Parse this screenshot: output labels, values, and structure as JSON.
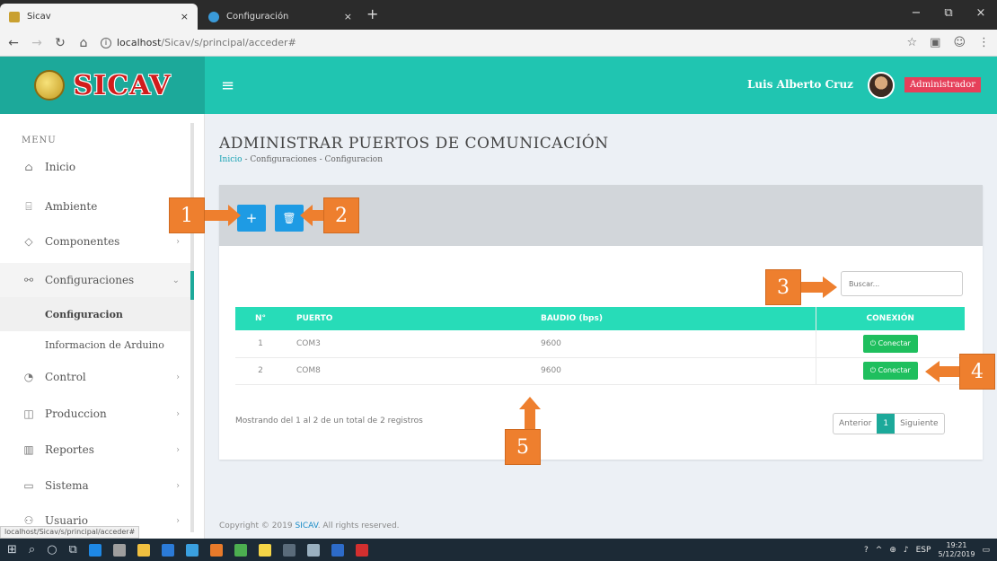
{
  "browser": {
    "tabs": [
      {
        "title": "Sicav",
        "close": "×"
      },
      {
        "title": "Configuración",
        "close": "×"
      }
    ],
    "new_tab": "+",
    "window_controls": {
      "minimize": "−",
      "maximize": "⧉",
      "close": "×"
    },
    "url_host": "localhost",
    "url_path": "/Sicav/s/principal/acceder#",
    "status_url": "localhost/Sicav/s/principal/acceder#"
  },
  "header": {
    "logo_text": "SICAV",
    "menu_icon": "hamburger-icon",
    "user_name": "Luis Alberto Cruz",
    "role": "Administrador"
  },
  "sidebar": {
    "title": "MENU",
    "items": [
      {
        "label": "Inicio",
        "icon": "home-icon"
      },
      {
        "label": "Ambiente",
        "icon": "bank-icon"
      },
      {
        "label": "Componentes",
        "icon": "cube-icon",
        "chevron": "›"
      },
      {
        "label": "Configuraciones",
        "icon": "link-icon",
        "chevron": "⌄"
      },
      {
        "label": "Configuracion"
      },
      {
        "label": "Informacion de Arduino"
      },
      {
        "label": "Control",
        "icon": "gauge-icon",
        "chevron": "›"
      },
      {
        "label": "Produccion",
        "icon": "box-icon",
        "chevron": "›"
      },
      {
        "label": "Reportes",
        "icon": "chart-icon",
        "chevron": "›"
      },
      {
        "label": "Sistema",
        "icon": "terminal-icon",
        "chevron": "›"
      },
      {
        "label": "Usuario",
        "icon": "users-icon",
        "chevron": "›"
      }
    ]
  },
  "main": {
    "title": "ADMINISTRAR PUERTOS DE COMUNICACIÓN",
    "breadcrumb": {
      "home": "Inicio",
      "sep": " - ",
      "level1": "Configuraciones",
      "level2": "Configuracion"
    },
    "add_button": "+",
    "delete_button": "🗑",
    "search_placeholder": "Buscar...",
    "table": {
      "headers": [
        "N°",
        "PUERTO",
        "BAUDIO (bps)",
        "CONEXIÓN"
      ],
      "rows": [
        {
          "n": "1",
          "port": "COM3",
          "baud": "9600",
          "action": "⏻ Conectar"
        },
        {
          "n": "2",
          "port": "COM8",
          "baud": "9600",
          "action": "⏻ Conectar"
        }
      ]
    },
    "showing_text": "Mostrando del 1 al 2 de un total de 2 registros",
    "pager": {
      "prev": "Anterior",
      "current": "1",
      "next": "Siguiente"
    },
    "footer": {
      "prefix": "Copyright © 2019 ",
      "brand": "SICAV",
      "suffix": ". All rights reserved."
    }
  },
  "callouts": [
    "1",
    "2",
    "3",
    "4",
    "5"
  ],
  "taskbar": {
    "lang": "ESP",
    "time": "19:21",
    "date": "5/12/2019"
  },
  "colors": {
    "header_teal": "#20c5b1",
    "logo_teal": "#1ca99a",
    "table_header": "#27dcb8",
    "button_blue": "#1e9be4",
    "connect_green": "#1fbf5e",
    "callout_orange": "#ee7f2e",
    "role_badge": "#e6405a"
  }
}
